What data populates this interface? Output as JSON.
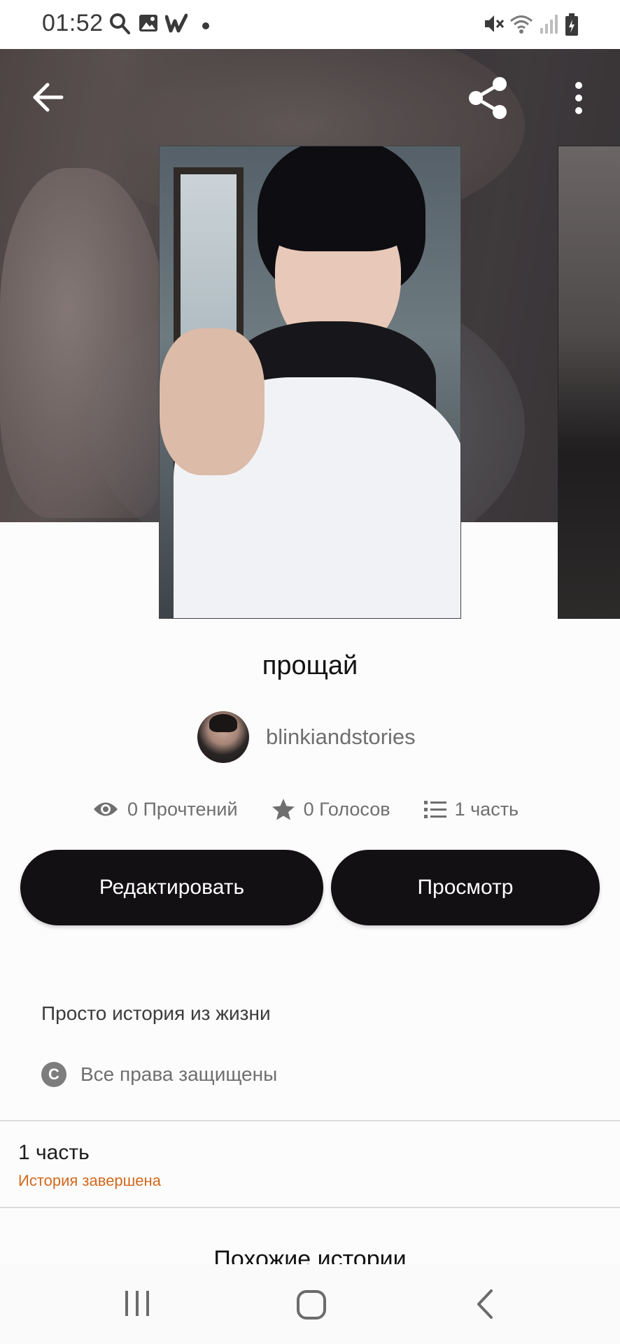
{
  "status_bar": {
    "time": "01:52",
    "left_icons": [
      "search-icon",
      "gallery-icon",
      "wattpad-icon",
      "dot-icon"
    ],
    "right_icons": [
      "mute-icon",
      "wifi-icon",
      "signal-icon",
      "battery-icon"
    ]
  },
  "header": {
    "back_icon": "arrow-left-icon",
    "share_icon": "share-icon",
    "menu_icon": "more-vertical-icon"
  },
  "story": {
    "title": "прощай",
    "author": "blinkiandstories",
    "stats": {
      "reads": "0 Прочтений",
      "votes": "0 Голосов",
      "parts": "1 часть"
    },
    "edit_label": "Редактировать",
    "view_label": "Просмотр",
    "description": "Просто история из жизни",
    "license_icon": "C",
    "license": "Все права защищены",
    "parts_count": "1 часть",
    "status": "История завершена"
  },
  "similar": {
    "title": "Похожие истории"
  },
  "nav": {
    "recents_icon": "recents-icon",
    "home_icon": "home-icon",
    "back_icon": "back-chevron-icon"
  },
  "colors": {
    "button_bg": "#121012",
    "status_accent": "#d2691e"
  }
}
